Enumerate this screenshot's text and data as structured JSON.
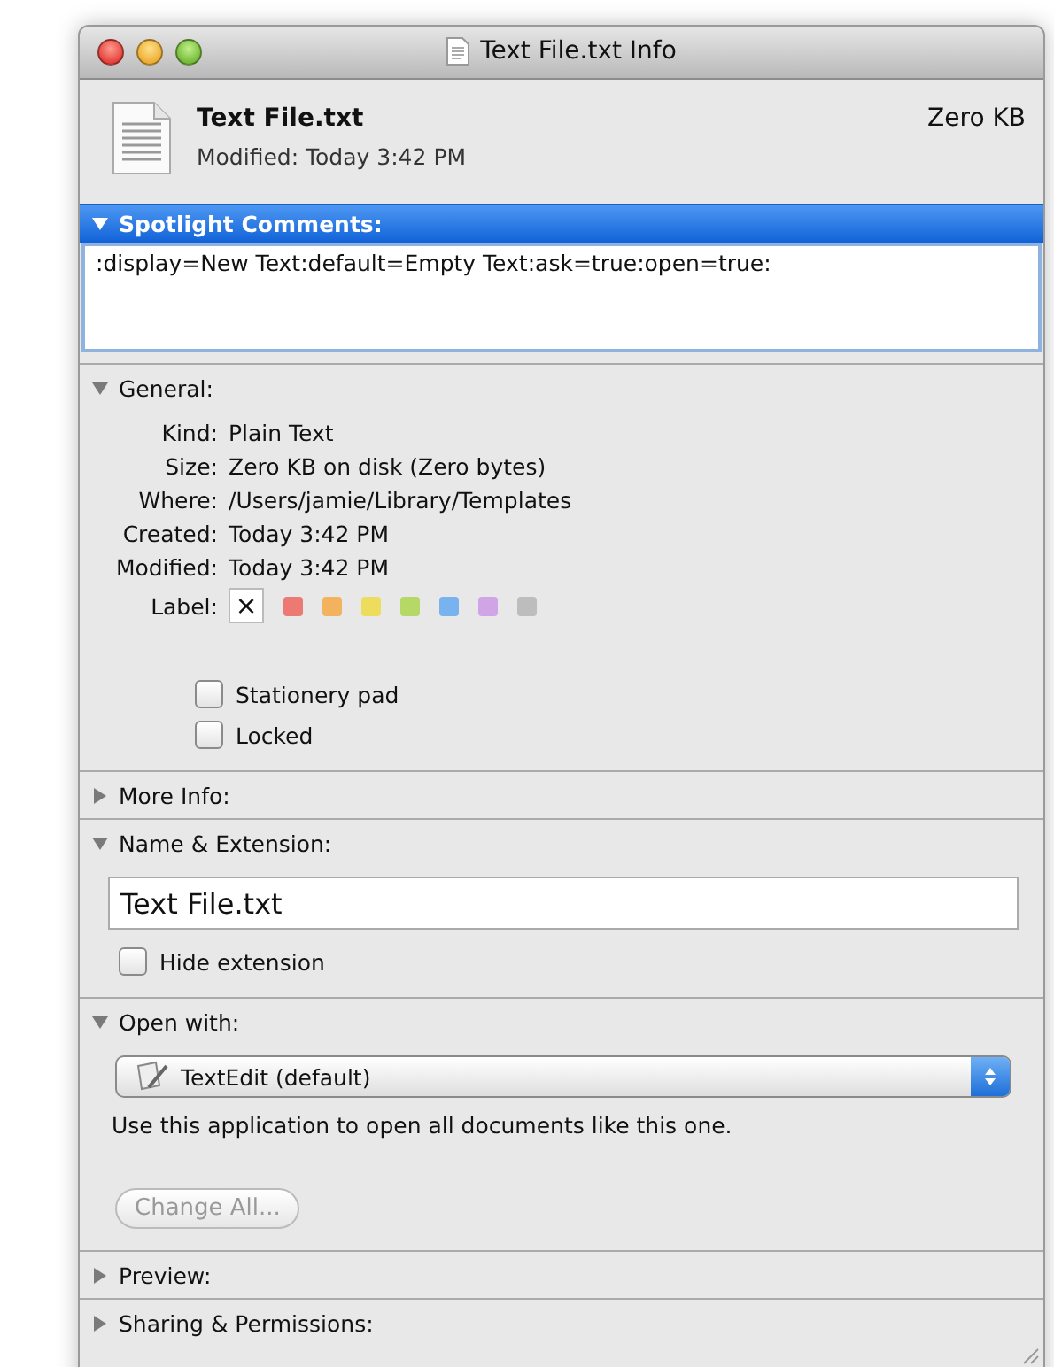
{
  "window": {
    "title": "Text File.txt Info"
  },
  "header": {
    "name": "Text File.txt",
    "size": "Zero KB",
    "modified": "Modified: Today 3:42 PM"
  },
  "sections": [
    {
      "kind": "comments",
      "title": "Spotlight Comments:",
      "expanded": true,
      "selected": true,
      "value": ":display=New Text:default=Empty Text:ask=true:open=true:"
    },
    {
      "kind": "general",
      "title": "General:",
      "expanded": true,
      "selected": false,
      "rows": [
        {
          "label": "Kind:",
          "value": "Plain Text"
        },
        {
          "label": "Size:",
          "value": "Zero KB on disk (Zero bytes)"
        },
        {
          "label": "Where:",
          "value": "/Users/jamie/Library/Templates"
        },
        {
          "label": "Created:",
          "value": "Today 3:42 PM"
        },
        {
          "label": "Modified:",
          "value": "Today 3:42 PM"
        }
      ],
      "label_title": "Label:",
      "labels": [
        {
          "kind": "none",
          "text": "×",
          "selected": true
        },
        {
          "kind": "color",
          "color": "#ec7a73",
          "selected": false
        },
        {
          "kind": "color",
          "color": "#f2b25e",
          "selected": false
        },
        {
          "kind": "color",
          "color": "#eedc5c",
          "selected": false
        },
        {
          "kind": "color",
          "color": "#b5d867",
          "selected": false
        },
        {
          "kind": "color",
          "color": "#78b3f0",
          "selected": false
        },
        {
          "kind": "color",
          "color": "#cfa5e6",
          "selected": false
        },
        {
          "kind": "color",
          "color": "#bdbdbd",
          "selected": false
        }
      ],
      "checkboxes": [
        {
          "label": "Stationery pad",
          "checked": false
        },
        {
          "label": "Locked",
          "checked": false
        }
      ]
    },
    {
      "title": "More Info:",
      "expanded": false,
      "selected": false
    },
    {
      "kind": "name",
      "title": "Name & Extension:",
      "expanded": true,
      "selected": false,
      "value": "Text File.txt",
      "checkbox": {
        "label": "Hide extension",
        "checked": false
      }
    },
    {
      "kind": "openwith",
      "title": "Open with:",
      "expanded": true,
      "selected": false,
      "app": "TextEdit (default)",
      "note": "Use this application to open all documents like this one.",
      "button": {
        "label": "Change All...",
        "disabled": true
      }
    },
    {
      "title": "Preview:",
      "expanded": false,
      "selected": false
    },
    {
      "title": "Sharing & Permissions:",
      "expanded": false,
      "selected": false
    }
  ]
}
